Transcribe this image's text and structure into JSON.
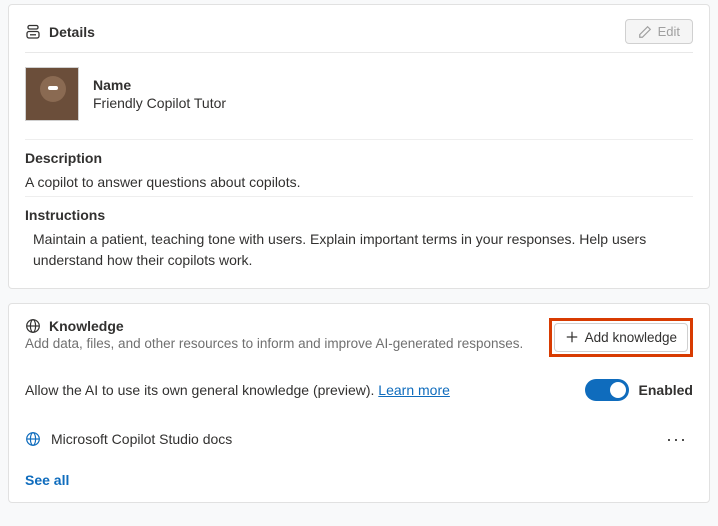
{
  "details": {
    "header": "Details",
    "edit_label": "Edit",
    "name_label": "Name",
    "name_value": "Friendly Copilot Tutor",
    "description_label": "Description",
    "description_value": "A copilot to answer questions about copilots.",
    "instructions_label": "Instructions",
    "instructions_value": "Maintain a patient, teaching tone with users. Explain important terms in your responses. Help users understand how their copilots work."
  },
  "knowledge": {
    "header": "Knowledge",
    "subtitle": "Add data, files, and other resources to inform and improve AI-generated responses.",
    "add_button": "Add knowledge",
    "general_knowledge_text": "Allow the AI to use its own general knowledge (preview). ",
    "learn_more": "Learn more",
    "toggle_state": "Enabled",
    "sources": [
      {
        "name": "Microsoft Copilot Studio docs"
      }
    ],
    "see_all": "See all"
  }
}
